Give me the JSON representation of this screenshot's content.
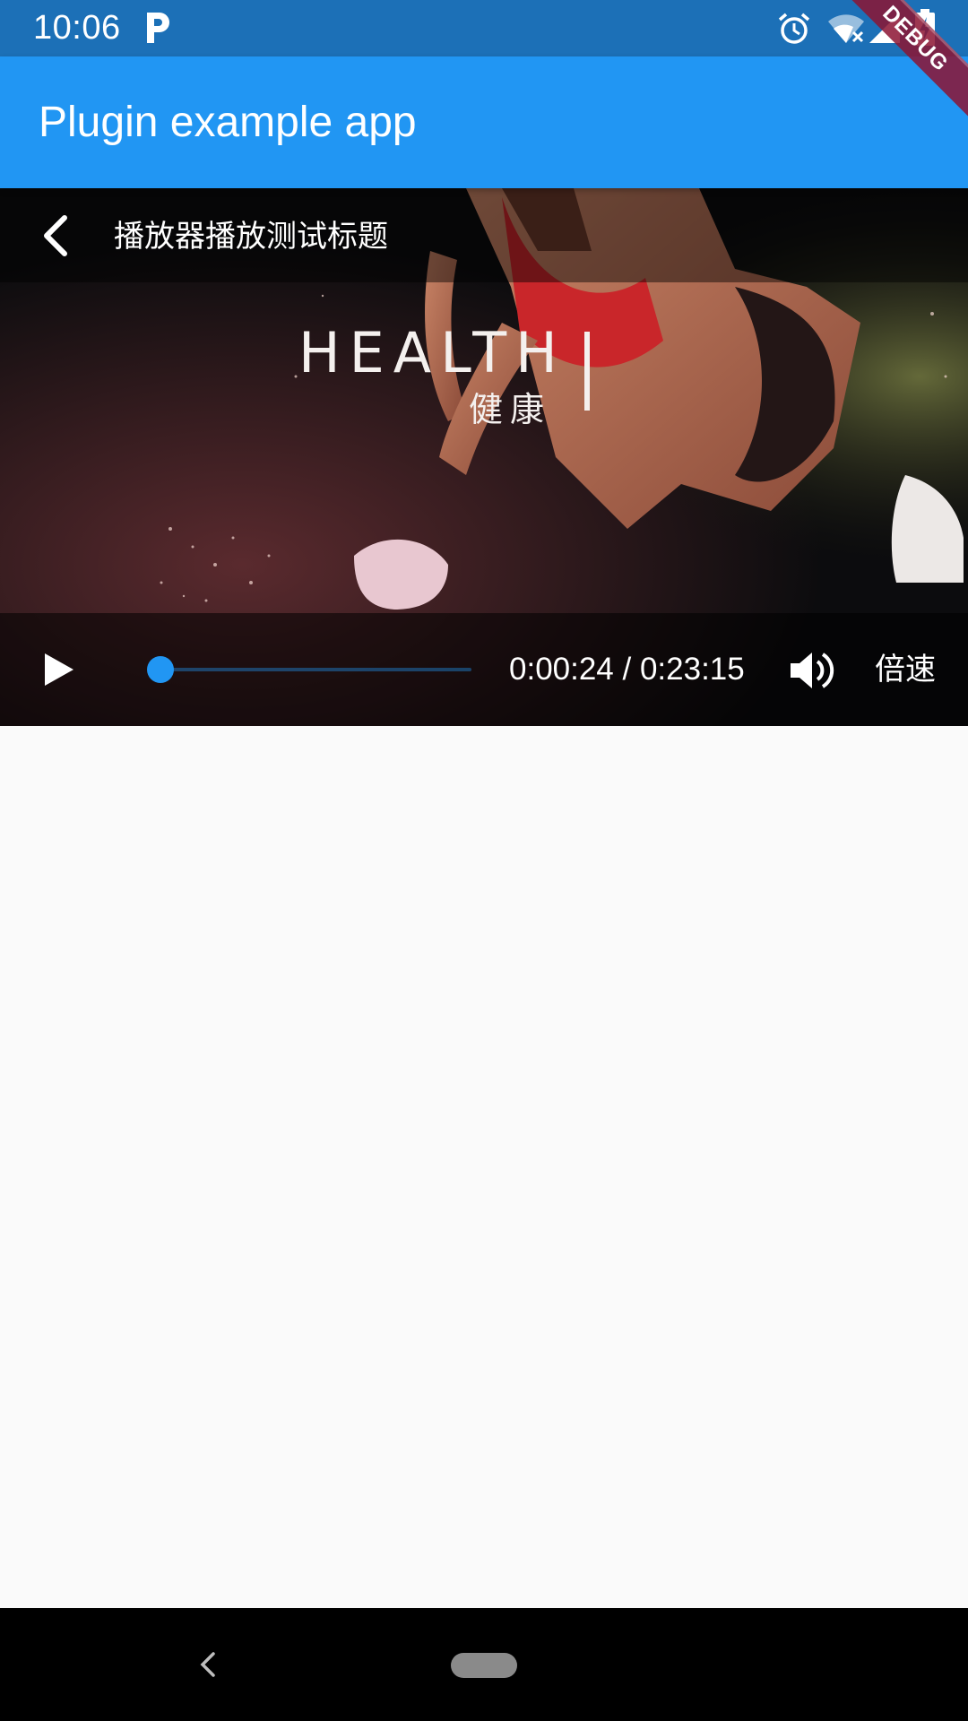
{
  "status_bar": {
    "time": "10:06",
    "icons": [
      "p-icon",
      "alarm-icon",
      "wifi-off-icon",
      "signal-icon",
      "battery-charging-icon"
    ]
  },
  "debug_banner": {
    "label": "DEBUG"
  },
  "app_bar": {
    "title": "Plugin example app"
  },
  "player": {
    "title": "播放器播放测试标题",
    "frame_text": {
      "brand": "HEALTH",
      "subtitle": "健康"
    },
    "position": "0:00:24",
    "duration": "0:23:15",
    "time_display": "0:00:24 / 0:23:15",
    "progress_fraction": 0.017,
    "speed_label": "倍速",
    "icons": [
      "back-icon",
      "play-icon",
      "volume-icon"
    ]
  },
  "nav_bar": {
    "icons": [
      "nav-back-icon",
      "nav-home-pill"
    ]
  },
  "colors": {
    "status_bar": "#1c70b7",
    "app_bar": "#2196f3",
    "accent": "#2196f3",
    "background": "#fafafa",
    "nav_bar": "#000000"
  }
}
